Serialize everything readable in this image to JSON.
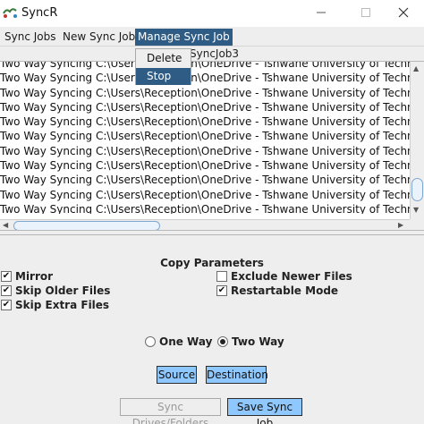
{
  "window": {
    "title": "SyncR",
    "app_icon": "syncr-logo-icon",
    "controls": [
      "minimize-icon",
      "maximize-icon",
      "close-icon"
    ]
  },
  "menubar": {
    "items": [
      {
        "label": "Sync Jobs"
      },
      {
        "label": "New Sync Job"
      },
      {
        "label": "Manage Sync Job",
        "active": true
      }
    ]
  },
  "manage_menu": {
    "items": [
      {
        "label": "Delete"
      },
      {
        "label": "Stop",
        "highlighted": true
      }
    ]
  },
  "tab": {
    "label": "SyncJob3"
  },
  "log": {
    "lines": [
      "Two Way Syncing C:\\Users\\Reception\\OneDrive - Tshwane University of Technology\\D",
      "Two Way Syncing C:\\Users\\Reception\\OneDrive - Tshwane University of Technology\\D",
      "Two Way Syncing C:\\Users\\Reception\\OneDrive - Tshwane University of Technology\\D",
      "Two Way Syncing C:\\Users\\Reception\\OneDrive - Tshwane University of Technology\\D",
      "Two Way Syncing C:\\Users\\Reception\\OneDrive - Tshwane University of Technology\\D",
      "Two Way Syncing C:\\Users\\Reception\\OneDrive - Tshwane University of Technology\\D",
      "Two Way Syncing C:\\Users\\Reception\\OneDrive - Tshwane University of Technology\\D",
      "Two Way Syncing C:\\Users\\Reception\\OneDrive - Tshwane University of Technology\\D",
      "Two Way Syncing C:\\Users\\Reception\\OneDrive - Tshwane University of Technology\\D",
      "Two Way Syncing C:\\Users\\Reception\\OneDrive - Tshwane University of Technology\\D",
      "Two Way Syncing C:\\Users\\Reception\\OneDrive - Tshwane University of Technology\\D"
    ]
  },
  "copy_parameters": {
    "title": "Copy Parameters",
    "mirror": {
      "label": "Mirror",
      "checked": true
    },
    "skip_older": {
      "label": "Skip Older Files",
      "checked": true
    },
    "skip_extra": {
      "label": "Skip Extra Files",
      "checked": true
    },
    "exclude_newer": {
      "label": "Exclude Newer Files",
      "checked": false
    },
    "restartable": {
      "label": "Restartable Mode",
      "checked": true
    }
  },
  "direction": {
    "one_way": {
      "label": "One Way",
      "selected": false
    },
    "two_way": {
      "label": "Two Way",
      "selected": true
    }
  },
  "buttons": {
    "source": "Source",
    "destination": "Destination",
    "sync_drives": "Sync Drives/Folders",
    "save": "Save Sync Job"
  },
  "colors": {
    "menu_highlight": "#2f5c85",
    "button_fill": "#8fc8ff",
    "disabled_text": "#9a9a9a"
  }
}
